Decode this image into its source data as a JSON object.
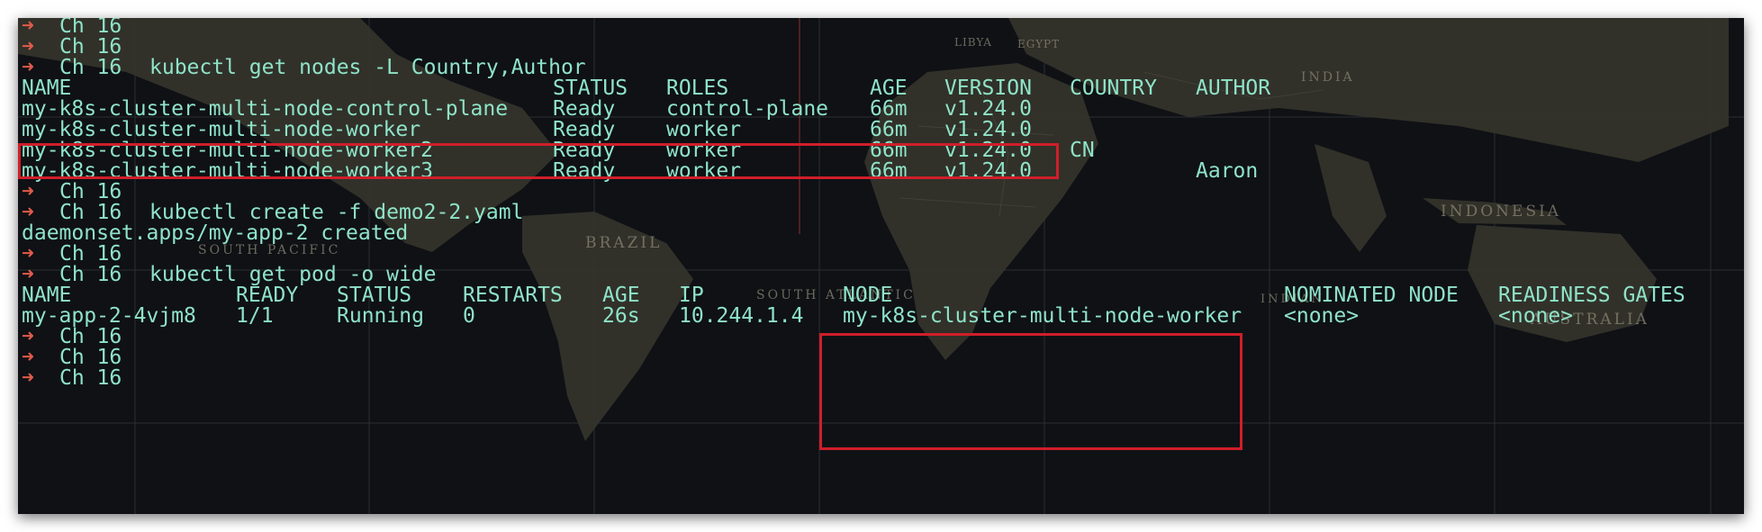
{
  "terminal": {
    "prompt_symbol": "➜",
    "prompt_dir": "Ch 16",
    "commands": {
      "get_nodes": "kubectl get nodes -L Country,Author",
      "create": "kubectl create -f demo2-2.yaml",
      "get_pod": "kubectl get pod -o wide"
    },
    "nodes_table": {
      "headers": {
        "name": "NAME",
        "status": "STATUS",
        "roles": "ROLES",
        "age": "AGE",
        "version": "VERSION",
        "country": "COUNTRY",
        "author": "AUTHOR"
      },
      "rows": [
        {
          "name": "my-k8s-cluster-multi-node-control-plane",
          "status": "Ready",
          "roles": "control-plane",
          "age": "66m",
          "version": "v1.24.0",
          "country": "",
          "author": ""
        },
        {
          "name": "my-k8s-cluster-multi-node-worker",
          "status": "Ready",
          "roles": "worker",
          "age": "66m",
          "version": "v1.24.0",
          "country": "",
          "author": ""
        },
        {
          "name": "my-k8s-cluster-multi-node-worker2",
          "status": "Ready",
          "roles": "worker",
          "age": "66m",
          "version": "v1.24.0",
          "country": "CN",
          "author": ""
        },
        {
          "name": "my-k8s-cluster-multi-node-worker3",
          "status": "Ready",
          "roles": "worker",
          "age": "66m",
          "version": "v1.24.0",
          "country": "",
          "author": "Aaron"
        }
      ]
    },
    "create_output": "daemonset.apps/my-app-2 created",
    "pods_table": {
      "headers": {
        "name": "NAME",
        "ready": "READY",
        "status": "STATUS",
        "restarts": "RESTARTS",
        "age": "AGE",
        "ip": "IP",
        "node": "NODE",
        "nominated": "NOMINATED NODE",
        "readiness": "READINESS GATES"
      },
      "rows": [
        {
          "name": "my-app-2-4vjm8",
          "ready": "1/1",
          "status": "Running",
          "restarts": "0",
          "age": "26s",
          "ip": "10.244.1.4",
          "node": "my-k8s-cluster-multi-node-worker",
          "nominated": "<none>",
          "readiness": "<none>"
        }
      ]
    }
  },
  "map_labels": {
    "brazil": "BRAZIL",
    "south_pacific": "SOUTH PACIFIC",
    "south_atlantic": "SOUTH ATLANTIC",
    "indonesia": "INDONESIA",
    "australia": "AUSTRALIA",
    "indian": "INDIAN",
    "libya": "LIBYA",
    "egypt": "EGYPT",
    "india": "INDIA"
  },
  "colors": {
    "background": "#0f1115",
    "text": "#8fe3c8",
    "prompt_arrow": "#e25c4a",
    "highlight_box": "#d01e2a"
  }
}
